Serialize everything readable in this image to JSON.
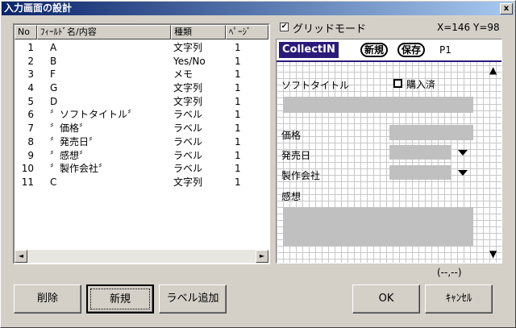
{
  "window": {
    "title": "入力画面の設計",
    "close": "x"
  },
  "list": {
    "headers": [
      "No",
      "ﾌｨｰﾙﾄﾞ名/内容",
      "種類",
      "ﾍﾟｰｼﾞ"
    ],
    "rows": [
      {
        "no": "1",
        "name": "A",
        "type": "文字列",
        "page": "1"
      },
      {
        "no": "2",
        "name": "B",
        "type": "Yes/No",
        "page": "1"
      },
      {
        "no": "3",
        "name": "F",
        "type": "メモ",
        "page": "1"
      },
      {
        "no": "4",
        "name": "G",
        "type": "文字列",
        "page": "1"
      },
      {
        "no": "5",
        "name": "D",
        "type": "文字列",
        "page": "1"
      },
      {
        "no": "6",
        "name": "〞ソフトタイトル〞",
        "type": "ラベル",
        "page": "1"
      },
      {
        "no": "7",
        "name": "〞価格〞",
        "type": "ラベル",
        "page": "1"
      },
      {
        "no": "8",
        "name": "〞発売日〞",
        "type": "ラベル",
        "page": "1"
      },
      {
        "no": "9",
        "name": "〞感想〞",
        "type": "ラベル",
        "page": "1"
      },
      {
        "no": "10",
        "name": "〞製作会社〞",
        "type": "ラベル",
        "page": "1"
      },
      {
        "no": "11",
        "name": "C",
        "type": "文字列",
        "page": "1"
      }
    ],
    "scroll_left": "◄",
    "scroll_right": "►"
  },
  "grid_mode": {
    "label": "グリッドモード",
    "check": "✔"
  },
  "coords": "X=146  Y=98",
  "device": {
    "app_title": "CollectIN",
    "new_btn": "新規",
    "save_btn": "保存",
    "page": "P1",
    "labels": {
      "soft_title": "ソフトタイトル",
      "purchased": "購入済",
      "price": "価格",
      "release": "発売日",
      "maker": "製作会社",
      "impression": "感想"
    },
    "scroll_up": "▲",
    "scroll_down": "▼"
  },
  "position_readout": "(--,--)",
  "buttons": {
    "delete": "削除",
    "new": "新規",
    "add_label": "ラベル追加",
    "ok": "OK",
    "cancel": "ｷｬﾝｾﾙ"
  }
}
